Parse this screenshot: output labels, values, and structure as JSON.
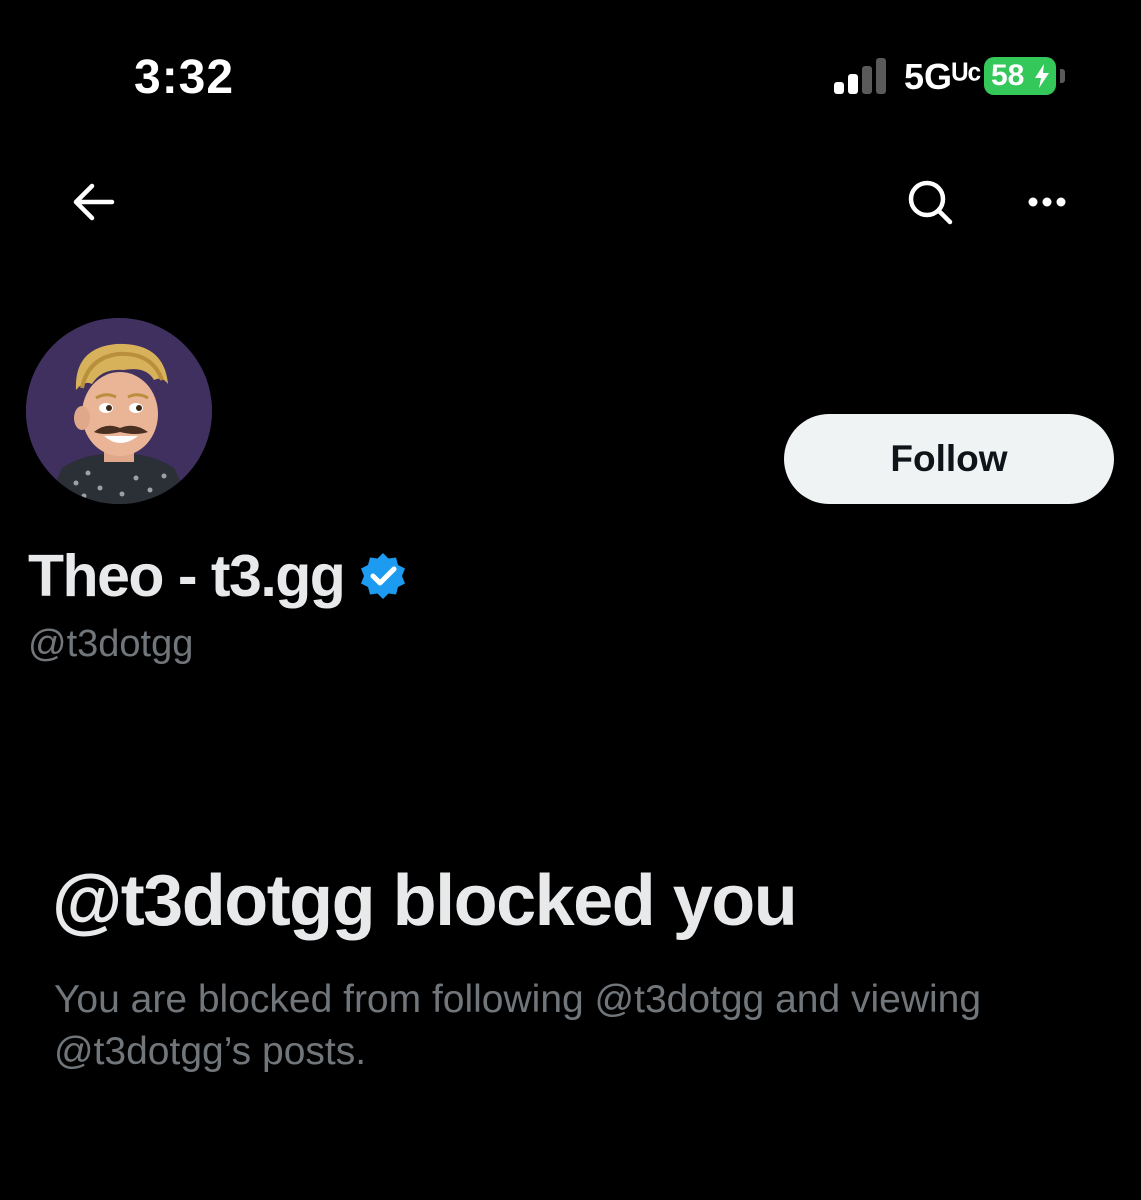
{
  "status_bar": {
    "time": "3:32",
    "network": "5Gᵁᶜ",
    "battery": "58",
    "icons": {
      "signal": "cellular-signal-icon",
      "battery": "battery-charging-icon"
    },
    "colors": {
      "battery": "#34c759"
    }
  },
  "nav": {
    "back_icon": "arrow-left-icon",
    "search_icon": "search-icon",
    "more_icon": "more-horizontal-icon"
  },
  "profile": {
    "display_name": "Theo - t3.gg",
    "handle": "@t3dotgg",
    "verified_icon": "verified-badge-icon",
    "follow_label": "Follow",
    "colors": {
      "verified": "#1d9bf0",
      "secondary_text": "#71767b",
      "primary_text": "#e7e9ea",
      "background": "#000000"
    }
  },
  "blocked": {
    "title": "@t3dotgg blocked you",
    "description": "You are blocked from following @t3dotgg and viewing @t3dotgg’s posts."
  }
}
